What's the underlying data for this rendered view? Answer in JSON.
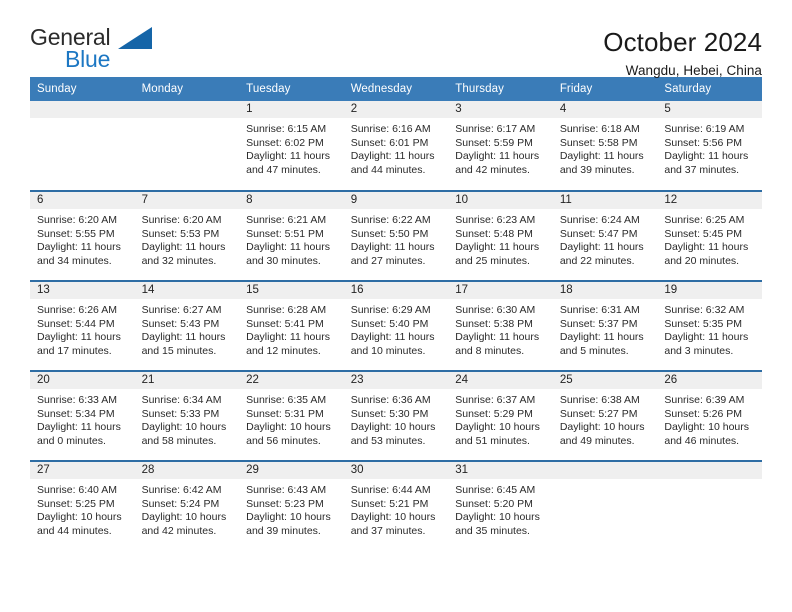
{
  "brand": {
    "name_top": "General",
    "name_bottom": "Blue",
    "accent_color": "#1c77c3",
    "triangle_color": "#1565a8"
  },
  "header": {
    "title": "October 2024",
    "subtitle": "Wangdu, Hebei, China"
  },
  "theme": {
    "header_row_color": "#3a7cb8",
    "row_divider_color": "#2e6da4",
    "date_band_color": "#efefef"
  },
  "weekday_headers": [
    "Sunday",
    "Monday",
    "Tuesday",
    "Wednesday",
    "Thursday",
    "Friday",
    "Saturday"
  ],
  "labels": {
    "sunrise_prefix": "Sunrise:",
    "sunset_prefix": "Sunset:",
    "daylight_prefix": "Daylight:"
  },
  "weeks": [
    [
      {
        "day": "",
        "sunrise": "",
        "sunset": "",
        "daylight": ""
      },
      {
        "day": "",
        "sunrise": "",
        "sunset": "",
        "daylight": ""
      },
      {
        "day": "1",
        "sunrise": "Sunrise: 6:15 AM",
        "sunset": "Sunset: 6:02 PM",
        "daylight": "Daylight: 11 hours and 47 minutes."
      },
      {
        "day": "2",
        "sunrise": "Sunrise: 6:16 AM",
        "sunset": "Sunset: 6:01 PM",
        "daylight": "Daylight: 11 hours and 44 minutes."
      },
      {
        "day": "3",
        "sunrise": "Sunrise: 6:17 AM",
        "sunset": "Sunset: 5:59 PM",
        "daylight": "Daylight: 11 hours and 42 minutes."
      },
      {
        "day": "4",
        "sunrise": "Sunrise: 6:18 AM",
        "sunset": "Sunset: 5:58 PM",
        "daylight": "Daylight: 11 hours and 39 minutes."
      },
      {
        "day": "5",
        "sunrise": "Sunrise: 6:19 AM",
        "sunset": "Sunset: 5:56 PM",
        "daylight": "Daylight: 11 hours and 37 minutes."
      }
    ],
    [
      {
        "day": "6",
        "sunrise": "Sunrise: 6:20 AM",
        "sunset": "Sunset: 5:55 PM",
        "daylight": "Daylight: 11 hours and 34 minutes."
      },
      {
        "day": "7",
        "sunrise": "Sunrise: 6:20 AM",
        "sunset": "Sunset: 5:53 PM",
        "daylight": "Daylight: 11 hours and 32 minutes."
      },
      {
        "day": "8",
        "sunrise": "Sunrise: 6:21 AM",
        "sunset": "Sunset: 5:51 PM",
        "daylight": "Daylight: 11 hours and 30 minutes."
      },
      {
        "day": "9",
        "sunrise": "Sunrise: 6:22 AM",
        "sunset": "Sunset: 5:50 PM",
        "daylight": "Daylight: 11 hours and 27 minutes."
      },
      {
        "day": "10",
        "sunrise": "Sunrise: 6:23 AM",
        "sunset": "Sunset: 5:48 PM",
        "daylight": "Daylight: 11 hours and 25 minutes."
      },
      {
        "day": "11",
        "sunrise": "Sunrise: 6:24 AM",
        "sunset": "Sunset: 5:47 PM",
        "daylight": "Daylight: 11 hours and 22 minutes."
      },
      {
        "day": "12",
        "sunrise": "Sunrise: 6:25 AM",
        "sunset": "Sunset: 5:45 PM",
        "daylight": "Daylight: 11 hours and 20 minutes."
      }
    ],
    [
      {
        "day": "13",
        "sunrise": "Sunrise: 6:26 AM",
        "sunset": "Sunset: 5:44 PM",
        "daylight": "Daylight: 11 hours and 17 minutes."
      },
      {
        "day": "14",
        "sunrise": "Sunrise: 6:27 AM",
        "sunset": "Sunset: 5:43 PM",
        "daylight": "Daylight: 11 hours and 15 minutes."
      },
      {
        "day": "15",
        "sunrise": "Sunrise: 6:28 AM",
        "sunset": "Sunset: 5:41 PM",
        "daylight": "Daylight: 11 hours and 12 minutes."
      },
      {
        "day": "16",
        "sunrise": "Sunrise: 6:29 AM",
        "sunset": "Sunset: 5:40 PM",
        "daylight": "Daylight: 11 hours and 10 minutes."
      },
      {
        "day": "17",
        "sunrise": "Sunrise: 6:30 AM",
        "sunset": "Sunset: 5:38 PM",
        "daylight": "Daylight: 11 hours and 8 minutes."
      },
      {
        "day": "18",
        "sunrise": "Sunrise: 6:31 AM",
        "sunset": "Sunset: 5:37 PM",
        "daylight": "Daylight: 11 hours and 5 minutes."
      },
      {
        "day": "19",
        "sunrise": "Sunrise: 6:32 AM",
        "sunset": "Sunset: 5:35 PM",
        "daylight": "Daylight: 11 hours and 3 minutes."
      }
    ],
    [
      {
        "day": "20",
        "sunrise": "Sunrise: 6:33 AM",
        "sunset": "Sunset: 5:34 PM",
        "daylight": "Daylight: 11 hours and 0 minutes."
      },
      {
        "day": "21",
        "sunrise": "Sunrise: 6:34 AM",
        "sunset": "Sunset: 5:33 PM",
        "daylight": "Daylight: 10 hours and 58 minutes."
      },
      {
        "day": "22",
        "sunrise": "Sunrise: 6:35 AM",
        "sunset": "Sunset: 5:31 PM",
        "daylight": "Daylight: 10 hours and 56 minutes."
      },
      {
        "day": "23",
        "sunrise": "Sunrise: 6:36 AM",
        "sunset": "Sunset: 5:30 PM",
        "daylight": "Daylight: 10 hours and 53 minutes."
      },
      {
        "day": "24",
        "sunrise": "Sunrise: 6:37 AM",
        "sunset": "Sunset: 5:29 PM",
        "daylight": "Daylight: 10 hours and 51 minutes."
      },
      {
        "day": "25",
        "sunrise": "Sunrise: 6:38 AM",
        "sunset": "Sunset: 5:27 PM",
        "daylight": "Daylight: 10 hours and 49 minutes."
      },
      {
        "day": "26",
        "sunrise": "Sunrise: 6:39 AM",
        "sunset": "Sunset: 5:26 PM",
        "daylight": "Daylight: 10 hours and 46 minutes."
      }
    ],
    [
      {
        "day": "27",
        "sunrise": "Sunrise: 6:40 AM",
        "sunset": "Sunset: 5:25 PM",
        "daylight": "Daylight: 10 hours and 44 minutes."
      },
      {
        "day": "28",
        "sunrise": "Sunrise: 6:42 AM",
        "sunset": "Sunset: 5:24 PM",
        "daylight": "Daylight: 10 hours and 42 minutes."
      },
      {
        "day": "29",
        "sunrise": "Sunrise: 6:43 AM",
        "sunset": "Sunset: 5:23 PM",
        "daylight": "Daylight: 10 hours and 39 minutes."
      },
      {
        "day": "30",
        "sunrise": "Sunrise: 6:44 AM",
        "sunset": "Sunset: 5:21 PM",
        "daylight": "Daylight: 10 hours and 37 minutes."
      },
      {
        "day": "31",
        "sunrise": "Sunrise: 6:45 AM",
        "sunset": "Sunset: 5:20 PM",
        "daylight": "Daylight: 10 hours and 35 minutes."
      },
      {
        "day": "",
        "sunrise": "",
        "sunset": "",
        "daylight": ""
      },
      {
        "day": "",
        "sunrise": "",
        "sunset": "",
        "daylight": ""
      }
    ]
  ]
}
